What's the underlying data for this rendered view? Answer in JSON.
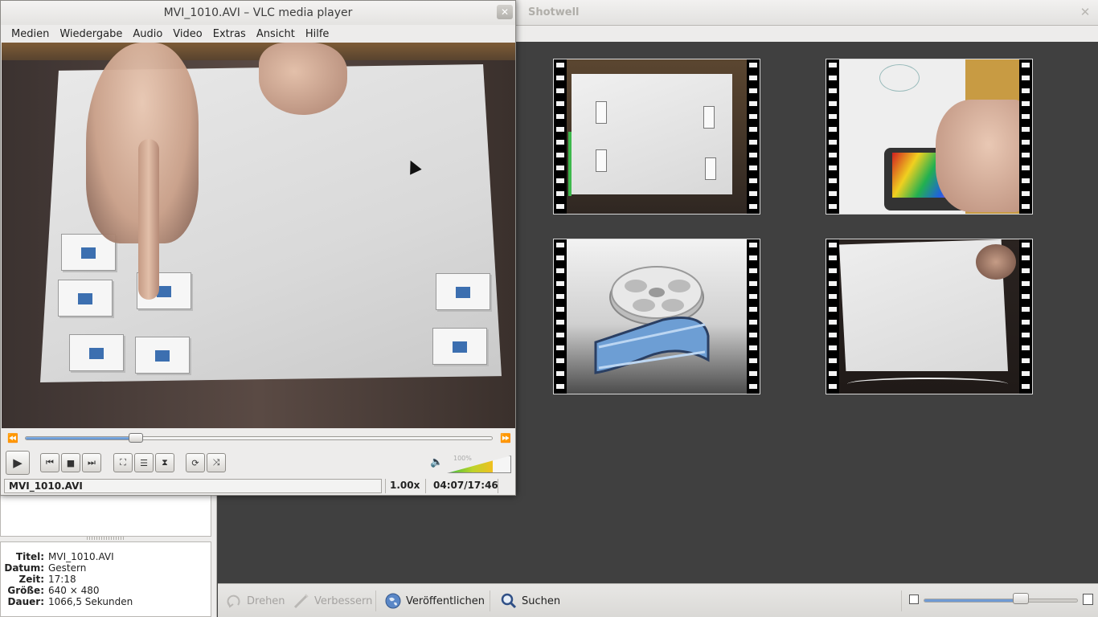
{
  "shotwell": {
    "title": "Shotwell",
    "close_glyph": "✕",
    "metadata": [
      {
        "key": "Titel:",
        "value": "MVI_1010.AVI"
      },
      {
        "key": "Datum:",
        "value": "Gestern"
      },
      {
        "key": "Zeit:",
        "value": "17:18"
      },
      {
        "key": "Größe:",
        "value": "640 × 480"
      },
      {
        "key": "Dauer:",
        "value": "1066,5 Sekunden"
      }
    ],
    "toolbar": {
      "rotate_label": "Drehen",
      "enhance_label": "Verbessern",
      "publish_label": "Veröffentlichen",
      "search_label": "Suchen",
      "zoom_level": 0.63
    },
    "thumbnails": [
      {
        "icon": "video-thumbnail-paper-cards"
      },
      {
        "icon": "video-thumbnail-phone"
      },
      {
        "icon": "video-thumbnail-film-reel"
      },
      {
        "icon": "video-thumbnail-blank-paper"
      }
    ]
  },
  "vlc": {
    "title": "MVI_1010.AVI – VLC media player",
    "close_glyph": "✕",
    "menu": [
      "Medien",
      "Wiedergabe",
      "Audio",
      "Video",
      "Extras",
      "Ansicht",
      "Hilfe"
    ],
    "seek_progress": 0.2365,
    "volume_label": "100%",
    "volume_level": 0.72,
    "status": {
      "file": "MVI_1010.AVI",
      "rate": "1.00x",
      "time": "04:07/17:46"
    },
    "icons": {
      "rewind": "⏪",
      "forward": "⏩",
      "play": "▶",
      "prev": "⏮",
      "stop": "■",
      "next": "⏭",
      "fullscreen": "⛶",
      "playlist": "☰",
      "effects": "⧗",
      "loop": "⟳",
      "shuffle": "⤨",
      "volume": "🔈"
    }
  }
}
